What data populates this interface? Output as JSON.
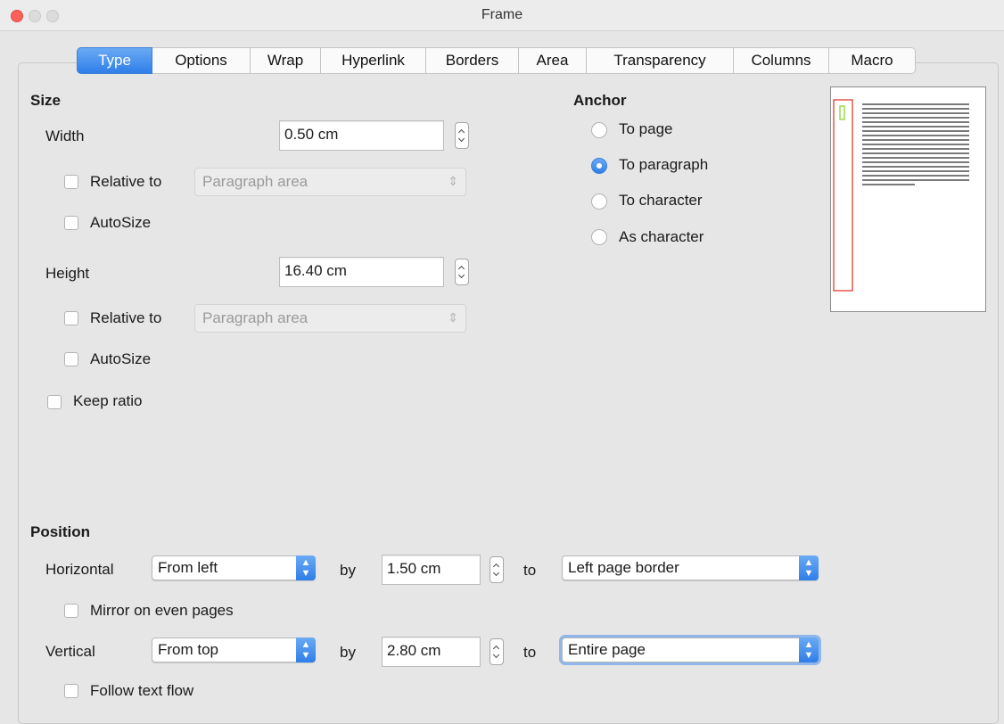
{
  "window": {
    "title": "Frame"
  },
  "tabs": [
    "Type",
    "Options",
    "Wrap",
    "Hyperlink",
    "Borders",
    "Area",
    "Transparency",
    "Columns",
    "Macro"
  ],
  "active_tab": "Type",
  "size": {
    "heading": "Size",
    "width_label": "Width",
    "width_value": "0.50 cm",
    "width_relative_label": "Relative to",
    "width_relative_value": "Paragraph area",
    "width_autosize_label": "AutoSize",
    "height_label": "Height",
    "height_value": "16.40 cm",
    "height_relative_label": "Relative to",
    "height_relative_value": "Paragraph area",
    "height_autosize_label": "AutoSize",
    "keep_ratio_label": "Keep ratio"
  },
  "anchor": {
    "heading": "Anchor",
    "options": [
      "To page",
      "To paragraph",
      "To character",
      "As character"
    ],
    "selected": "To paragraph"
  },
  "position": {
    "heading": "Position",
    "horizontal_label": "Horizontal",
    "horizontal_value": "From left",
    "by_label": "by",
    "horizontal_by": "1.50 cm",
    "to_label": "to",
    "horizontal_to": "Left page border",
    "mirror_label": "Mirror on even pages",
    "vertical_label": "Vertical",
    "vertical_value": "From top",
    "vertical_by": "2.80 cm",
    "vertical_to": "Entire page",
    "follow_label": "Follow text flow"
  },
  "colors": {
    "accent": "#2f7ee8",
    "frame_outline": "#e0301e",
    "anchor_marker": "#7ed321"
  }
}
